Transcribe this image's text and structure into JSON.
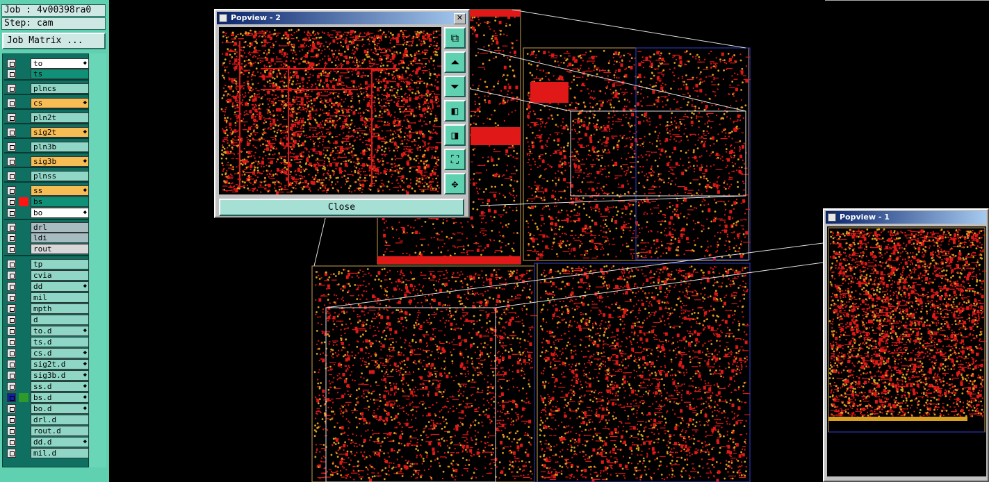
{
  "job": {
    "job_line": "Job : 4v00398ra0",
    "step_line": "Step: cam",
    "matrix_button": "Job Matrix ..."
  },
  "layers": [
    {
      "name": "to",
      "bg": "#ffffff",
      "swatch": "",
      "edit": true
    },
    {
      "name": "ts",
      "bg": "#119078",
      "swatch": "",
      "edit": false
    },
    {
      "name": "plncs",
      "bg": "#8fd6c6",
      "swatch": "",
      "edit": false
    },
    {
      "name": "cs",
      "bg": "#f7bd55",
      "swatch": "",
      "edit": true
    },
    {
      "name": "pln2t",
      "bg": "#8fd6c6",
      "swatch": "",
      "edit": false
    },
    {
      "name": "sig2t",
      "bg": "#f7bd55",
      "swatch": "",
      "edit": true
    },
    {
      "name": "pln3b",
      "bg": "#8fd6c6",
      "swatch": "",
      "edit": false
    },
    {
      "name": "sig3b",
      "bg": "#f7bd55",
      "swatch": "",
      "edit": true
    },
    {
      "name": "plnss",
      "bg": "#8fd6c6",
      "swatch": "",
      "edit": false
    },
    {
      "name": "ss",
      "bg": "#f7bd55",
      "swatch": "",
      "edit": true
    },
    {
      "name": "bs",
      "bg": "#119078",
      "swatch": "#ff1414",
      "edit": false
    },
    {
      "name": "bo",
      "bg": "#ffffff",
      "swatch": "",
      "edit": true
    },
    {
      "name": "drl",
      "bg": "#a7bcc0",
      "swatch": "",
      "edit": false
    },
    {
      "name": "ldi",
      "bg": "#a7bcc0",
      "swatch": "",
      "edit": false
    },
    {
      "name": "rout",
      "bg": "#d8d8d8",
      "swatch": "",
      "edit": false
    },
    {
      "name": "tp",
      "bg": "#8fd6c6",
      "swatch": "",
      "edit": false
    },
    {
      "name": "cvia",
      "bg": "#8fd6c6",
      "swatch": "",
      "edit": false
    },
    {
      "name": "dd",
      "bg": "#8fd6c6",
      "swatch": "",
      "edit": true
    },
    {
      "name": "mil",
      "bg": "#8fd6c6",
      "swatch": "",
      "edit": false
    },
    {
      "name": "mpth",
      "bg": "#8fd6c6",
      "swatch": "",
      "edit": false
    },
    {
      "name": "d",
      "bg": "#8fd6c6",
      "swatch": "",
      "edit": false
    },
    {
      "name": "to.d",
      "bg": "#8fd6c6",
      "swatch": "",
      "edit": true
    },
    {
      "name": "ts.d",
      "bg": "#8fd6c6",
      "swatch": "",
      "edit": false
    },
    {
      "name": "cs.d",
      "bg": "#8fd6c6",
      "swatch": "",
      "edit": true
    },
    {
      "name": "sig2t.d",
      "bg": "#8fd6c6",
      "swatch": "",
      "edit": true
    },
    {
      "name": "sig3b.d",
      "bg": "#8fd6c6",
      "swatch": "",
      "edit": true
    },
    {
      "name": "ss.d",
      "bg": "#8fd6c6",
      "swatch": "",
      "edit": true
    },
    {
      "name": "bs.d",
      "bg": "#8fd6c6",
      "swatch": "#2e9a2a",
      "edit": true,
      "cb_dark": true
    },
    {
      "name": "bo.d",
      "bg": "#8fd6c6",
      "swatch": "",
      "edit": true
    },
    {
      "name": "drl.d",
      "bg": "#8fd6c6",
      "swatch": "",
      "edit": false
    },
    {
      "name": "rout.d",
      "bg": "#8fd6c6",
      "swatch": "",
      "edit": false
    },
    {
      "name": "dd.d",
      "bg": "#8fd6c6",
      "swatch": "",
      "edit": true
    },
    {
      "name": "mil.d",
      "bg": "#8fd6c6",
      "swatch": "",
      "edit": false
    }
  ],
  "popview2": {
    "title": "Popview - 2",
    "close_label": "Close",
    "tools": [
      "zoom-home-icon",
      "pan-up-icon",
      "pan-down-icon",
      "pan-left-icon",
      "pan-right-icon",
      "zoom-fit-icon",
      "pan-center-icon"
    ]
  },
  "popview1": {
    "title": "Popview - 1"
  },
  "colors": {
    "trace": "#e01818",
    "pad": "#d8a020",
    "outline": "#c8a050",
    "board_edge": "#3040d0",
    "panel": "#5fd0b0"
  }
}
